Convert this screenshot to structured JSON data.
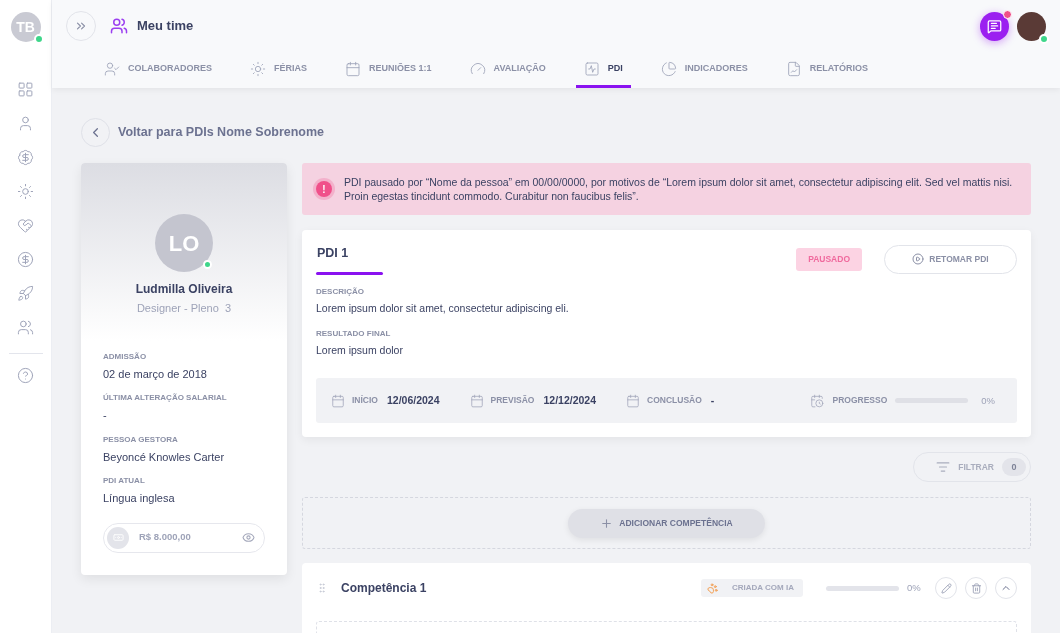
{
  "sidebar": {
    "initials": "TB",
    "online": true
  },
  "header": {
    "title": "Meu time",
    "chat_notification": true,
    "user_online": true
  },
  "tabs": [
    {
      "label": "COLABORADORES",
      "selected": false
    },
    {
      "label": "FÉRIAS",
      "selected": false
    },
    {
      "label": "REUNIÕES 1:1",
      "selected": false
    },
    {
      "label": "AVALIAÇÃO",
      "selected": false
    },
    {
      "label": "PDI",
      "selected": true
    },
    {
      "label": "INDICADORES",
      "selected": false
    },
    {
      "label": "RELATÓRIOS",
      "selected": false
    }
  ],
  "back_link": "Voltar para PDIs Nome Sobrenome",
  "profile": {
    "initials": "LO",
    "online": true,
    "name": "Ludmilla Oliveira",
    "role": "Designer - Pleno  3",
    "fields": [
      {
        "label": "ADMISSÃO",
        "value": "02 de março de 2018"
      },
      {
        "label": "ÚLTIMA ALTERAÇÃO SALARIAL",
        "value": "-"
      },
      {
        "label": "PESSOA GESTORA",
        "value": "Beyoncé Knowles Carter"
      },
      {
        "label": "PDI ATUAL",
        "value": "Língua inglesa"
      }
    ],
    "salary": "R$ 8.000,00"
  },
  "alert_icon": "!",
  "alert": "PDI pausado por “Nome da pessoa” em 00/00/0000, por motivos de “Lorem ipsum dolor sit amet, consectetur adipiscing elit. Sed vel mattis nisi. Proin egestas tincidunt commodo. Curabitur non faucibus felis”.",
  "pdi": {
    "title": "PDI 1",
    "status": "PAUSADO",
    "resume_button": "RETOMAR PDI",
    "sections": [
      {
        "label": "DESCRIÇÃO",
        "value": "Lorem ipsum dolor sit amet, consectetur adipiscing eli."
      },
      {
        "label": "RESULTADO FINAL",
        "value": "Lorem ipsum dolor"
      }
    ],
    "dates": [
      {
        "label": "INÍCIO",
        "value": "12/06/2024"
      },
      {
        "label": "PREVISÃO",
        "value": "12/12/2024"
      },
      {
        "label": "CONCLUSÃO",
        "value": "-"
      }
    ],
    "progress": {
      "label": "PROGRESSO",
      "level": 0,
      "reading": "0%"
    }
  },
  "filter": {
    "label": "FILTRAR",
    "count": "0",
    "disabled": true
  },
  "add_button": "ADICIONAR COMPETÊNCIA",
  "competencies": [
    {
      "title": "Competência 1",
      "tag": "CRIADA COM IA",
      "level": 0,
      "reading": "0%",
      "expanded": true
    }
  ]
}
